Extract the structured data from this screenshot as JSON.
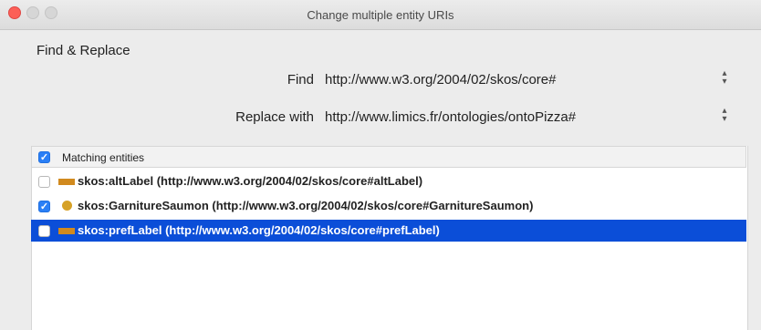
{
  "window": {
    "title": "Change multiple entity URIs"
  },
  "find_replace": {
    "section_title": "Find & Replace",
    "find_label": "Find",
    "find_value": "http://www.w3.org/2004/02/skos/core#",
    "replace_label": "Replace with",
    "replace_value": "http://www.limics.fr/ontologies/ontoPizza#"
  },
  "entities": {
    "header_label": "Matching entities",
    "header_checked": true,
    "rows": [
      {
        "text": "skos:altLabel (http://www.w3.org/2004/02/skos/core#altLabel)",
        "checked": false,
        "icon": "property-icon",
        "selected": false
      },
      {
        "text": "skos:GarnitureSaumon (http://www.w3.org/2004/02/skos/core#GarnitureSaumon)",
        "checked": true,
        "icon": "individual-icon",
        "selected": false
      },
      {
        "text": "skos:prefLabel (http://www.w3.org/2004/02/skos/core#prefLabel)",
        "checked": false,
        "icon": "property-icon",
        "selected": true
      }
    ]
  },
  "colors": {
    "selection": "#0b4ed8",
    "checkbox": "#2a7ff6",
    "property_icon": "#d18a1e",
    "individual_icon": "#d6a126"
  }
}
